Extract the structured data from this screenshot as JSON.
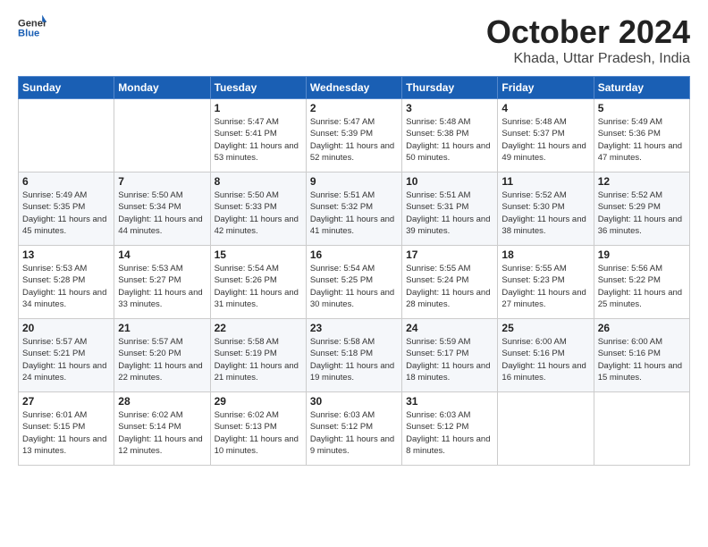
{
  "logo": {
    "general": "General",
    "blue": "Blue"
  },
  "header": {
    "month": "October 2024",
    "location": "Khada, Uttar Pradesh, India"
  },
  "days_of_week": [
    "Sunday",
    "Monday",
    "Tuesday",
    "Wednesday",
    "Thursday",
    "Friday",
    "Saturday"
  ],
  "weeks": [
    [
      {
        "day": "",
        "sunrise": "",
        "sunset": "",
        "daylight": ""
      },
      {
        "day": "",
        "sunrise": "",
        "sunset": "",
        "daylight": ""
      },
      {
        "day": "1",
        "sunrise": "Sunrise: 5:47 AM",
        "sunset": "Sunset: 5:41 PM",
        "daylight": "Daylight: 11 hours and 53 minutes."
      },
      {
        "day": "2",
        "sunrise": "Sunrise: 5:47 AM",
        "sunset": "Sunset: 5:39 PM",
        "daylight": "Daylight: 11 hours and 52 minutes."
      },
      {
        "day": "3",
        "sunrise": "Sunrise: 5:48 AM",
        "sunset": "Sunset: 5:38 PM",
        "daylight": "Daylight: 11 hours and 50 minutes."
      },
      {
        "day": "4",
        "sunrise": "Sunrise: 5:48 AM",
        "sunset": "Sunset: 5:37 PM",
        "daylight": "Daylight: 11 hours and 49 minutes."
      },
      {
        "day": "5",
        "sunrise": "Sunrise: 5:49 AM",
        "sunset": "Sunset: 5:36 PM",
        "daylight": "Daylight: 11 hours and 47 minutes."
      }
    ],
    [
      {
        "day": "6",
        "sunrise": "Sunrise: 5:49 AM",
        "sunset": "Sunset: 5:35 PM",
        "daylight": "Daylight: 11 hours and 45 minutes."
      },
      {
        "day": "7",
        "sunrise": "Sunrise: 5:50 AM",
        "sunset": "Sunset: 5:34 PM",
        "daylight": "Daylight: 11 hours and 44 minutes."
      },
      {
        "day": "8",
        "sunrise": "Sunrise: 5:50 AM",
        "sunset": "Sunset: 5:33 PM",
        "daylight": "Daylight: 11 hours and 42 minutes."
      },
      {
        "day": "9",
        "sunrise": "Sunrise: 5:51 AM",
        "sunset": "Sunset: 5:32 PM",
        "daylight": "Daylight: 11 hours and 41 minutes."
      },
      {
        "day": "10",
        "sunrise": "Sunrise: 5:51 AM",
        "sunset": "Sunset: 5:31 PM",
        "daylight": "Daylight: 11 hours and 39 minutes."
      },
      {
        "day": "11",
        "sunrise": "Sunrise: 5:52 AM",
        "sunset": "Sunset: 5:30 PM",
        "daylight": "Daylight: 11 hours and 38 minutes."
      },
      {
        "day": "12",
        "sunrise": "Sunrise: 5:52 AM",
        "sunset": "Sunset: 5:29 PM",
        "daylight": "Daylight: 11 hours and 36 minutes."
      }
    ],
    [
      {
        "day": "13",
        "sunrise": "Sunrise: 5:53 AM",
        "sunset": "Sunset: 5:28 PM",
        "daylight": "Daylight: 11 hours and 34 minutes."
      },
      {
        "day": "14",
        "sunrise": "Sunrise: 5:53 AM",
        "sunset": "Sunset: 5:27 PM",
        "daylight": "Daylight: 11 hours and 33 minutes."
      },
      {
        "day": "15",
        "sunrise": "Sunrise: 5:54 AM",
        "sunset": "Sunset: 5:26 PM",
        "daylight": "Daylight: 11 hours and 31 minutes."
      },
      {
        "day": "16",
        "sunrise": "Sunrise: 5:54 AM",
        "sunset": "Sunset: 5:25 PM",
        "daylight": "Daylight: 11 hours and 30 minutes."
      },
      {
        "day": "17",
        "sunrise": "Sunrise: 5:55 AM",
        "sunset": "Sunset: 5:24 PM",
        "daylight": "Daylight: 11 hours and 28 minutes."
      },
      {
        "day": "18",
        "sunrise": "Sunrise: 5:55 AM",
        "sunset": "Sunset: 5:23 PM",
        "daylight": "Daylight: 11 hours and 27 minutes."
      },
      {
        "day": "19",
        "sunrise": "Sunrise: 5:56 AM",
        "sunset": "Sunset: 5:22 PM",
        "daylight": "Daylight: 11 hours and 25 minutes."
      }
    ],
    [
      {
        "day": "20",
        "sunrise": "Sunrise: 5:57 AM",
        "sunset": "Sunset: 5:21 PM",
        "daylight": "Daylight: 11 hours and 24 minutes."
      },
      {
        "day": "21",
        "sunrise": "Sunrise: 5:57 AM",
        "sunset": "Sunset: 5:20 PM",
        "daylight": "Daylight: 11 hours and 22 minutes."
      },
      {
        "day": "22",
        "sunrise": "Sunrise: 5:58 AM",
        "sunset": "Sunset: 5:19 PM",
        "daylight": "Daylight: 11 hours and 21 minutes."
      },
      {
        "day": "23",
        "sunrise": "Sunrise: 5:58 AM",
        "sunset": "Sunset: 5:18 PM",
        "daylight": "Daylight: 11 hours and 19 minutes."
      },
      {
        "day": "24",
        "sunrise": "Sunrise: 5:59 AM",
        "sunset": "Sunset: 5:17 PM",
        "daylight": "Daylight: 11 hours and 18 minutes."
      },
      {
        "day": "25",
        "sunrise": "Sunrise: 6:00 AM",
        "sunset": "Sunset: 5:16 PM",
        "daylight": "Daylight: 11 hours and 16 minutes."
      },
      {
        "day": "26",
        "sunrise": "Sunrise: 6:00 AM",
        "sunset": "Sunset: 5:16 PM",
        "daylight": "Daylight: 11 hours and 15 minutes."
      }
    ],
    [
      {
        "day": "27",
        "sunrise": "Sunrise: 6:01 AM",
        "sunset": "Sunset: 5:15 PM",
        "daylight": "Daylight: 11 hours and 13 minutes."
      },
      {
        "day": "28",
        "sunrise": "Sunrise: 6:02 AM",
        "sunset": "Sunset: 5:14 PM",
        "daylight": "Daylight: 11 hours and 12 minutes."
      },
      {
        "day": "29",
        "sunrise": "Sunrise: 6:02 AM",
        "sunset": "Sunset: 5:13 PM",
        "daylight": "Daylight: 11 hours and 10 minutes."
      },
      {
        "day": "30",
        "sunrise": "Sunrise: 6:03 AM",
        "sunset": "Sunset: 5:12 PM",
        "daylight": "Daylight: 11 hours and 9 minutes."
      },
      {
        "day": "31",
        "sunrise": "Sunrise: 6:03 AM",
        "sunset": "Sunset: 5:12 PM",
        "daylight": "Daylight: 11 hours and 8 minutes."
      },
      {
        "day": "",
        "sunrise": "",
        "sunset": "",
        "daylight": ""
      },
      {
        "day": "",
        "sunrise": "",
        "sunset": "",
        "daylight": ""
      }
    ]
  ]
}
